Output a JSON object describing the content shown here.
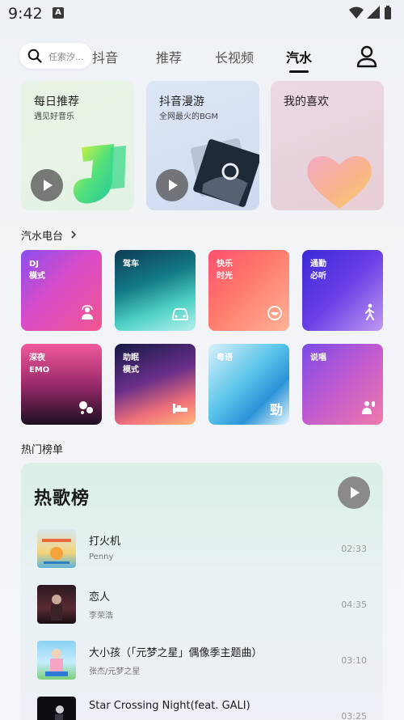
{
  "status": {
    "time": "9:42",
    "notif_letter": "A"
  },
  "nav": {
    "search_placeholder": "任索汐...",
    "tabs": [
      "抖音",
      "推荐",
      "长视频",
      "汽水"
    ],
    "active_tab": "汽水"
  },
  "features": [
    {
      "title": "每日推荐",
      "subtitle": "遇见好音乐"
    },
    {
      "title": "抖音漫游",
      "subtitle": "全网最火的BGM"
    },
    {
      "title": "我的喜欢",
      "subtitle": ""
    }
  ],
  "radio_section": {
    "title": "汽水电台"
  },
  "radios": [
    {
      "label": "DJ\n模式",
      "line1": "DJ",
      "line2": "模式",
      "icon": "dj-icon"
    },
    {
      "line1": "驾车",
      "line2": "",
      "icon": "car-icon"
    },
    {
      "line1": "快乐",
      "line2": "时光",
      "icon": "smile-icon"
    },
    {
      "line1": "通勤",
      "line2": "必听",
      "icon": "walk-icon"
    },
    {
      "line1": "深夜",
      "line2": "EMO",
      "icon": "sleepy-icon"
    },
    {
      "line1": "助眠",
      "line2": "模式",
      "icon": "bed-icon"
    },
    {
      "line1": "粤语",
      "line2": "",
      "icon": "cantonese-icon",
      "badge": "勁"
    },
    {
      "line1": "说唱",
      "line2": "",
      "icon": "rap-icon"
    }
  ],
  "charts_section": {
    "title": "热门榜单"
  },
  "chart": {
    "title": "热歌榜",
    "songs": [
      {
        "title": "打火机",
        "artist": "Penny",
        "duration": "02:33"
      },
      {
        "title": "恋人",
        "artist": "李荣浩",
        "duration": "04:35"
      },
      {
        "title": "大小孩（「元梦之星」偶像季主题曲）",
        "artist": "张杰/元梦之星",
        "duration": "03:10"
      },
      {
        "title": "Star Crossing Night(feat. GALI)",
        "artist": "",
        "duration": "03:25"
      }
    ]
  }
}
